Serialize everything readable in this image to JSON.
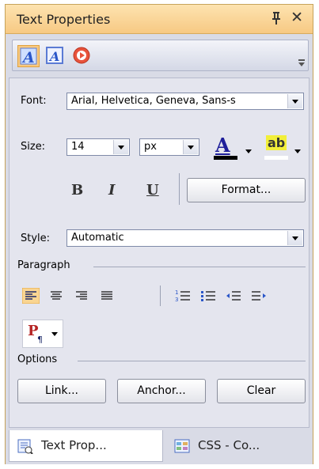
{
  "panel": {
    "title": "Text Properties"
  },
  "toolbar": {
    "items": [
      {
        "icon": "text-style-icon",
        "active": true
      },
      {
        "icon": "text-frame-icon",
        "active": false
      },
      {
        "icon": "record-icon",
        "active": false
      }
    ]
  },
  "font": {
    "label": "Font:",
    "value": "Arial, Helvetica, Geneva, Sans-s"
  },
  "size": {
    "label": "Size:",
    "value": "14",
    "unit": "px"
  },
  "color": {
    "font_color_glyph": "A",
    "font_color": "#1f1f9a",
    "font_color_bar": "#000000",
    "highlight_glyph": "ab",
    "highlight_color": "#f2ef3a"
  },
  "formatting": {
    "bold": "B",
    "italic": "I",
    "underline": "U",
    "format_button": "Format..."
  },
  "style": {
    "label": "Style:",
    "value": "Automatic"
  },
  "paragraph": {
    "header": "Paragraph",
    "paragraph_glyph": "P"
  },
  "options": {
    "header": "Options",
    "link": "Link...",
    "anchor": "Anchor...",
    "clear": "Clear"
  },
  "tabs": [
    {
      "label": "Text Prop...",
      "active": true
    },
    {
      "label": "CSS - Co...",
      "active": false
    }
  ]
}
